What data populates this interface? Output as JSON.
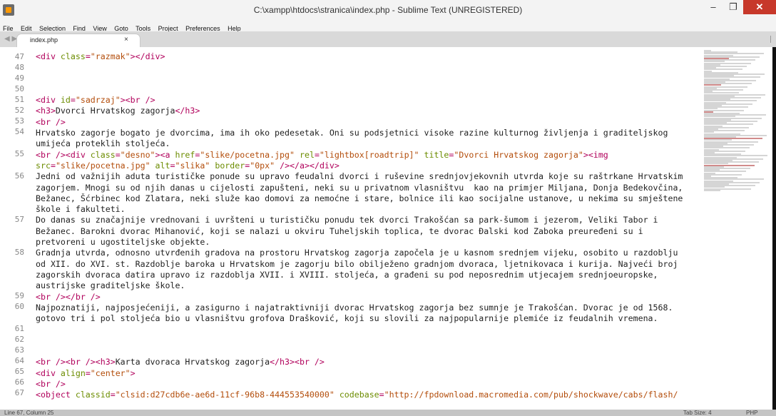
{
  "window": {
    "title": "C:\\xampp\\htdocs\\stranica\\index.php - Sublime Text (UNREGISTERED)",
    "minimize": "–",
    "maximize": "❐",
    "close": "✕"
  },
  "menu": [
    "File",
    "Edit",
    "Selection",
    "Find",
    "View",
    "Goto",
    "Tools",
    "Project",
    "Preferences",
    "Help"
  ],
  "tabs": [
    {
      "label": "index.php",
      "close": "×"
    }
  ],
  "nav_arrows": "◀ ▶",
  "editor": {
    "lines": [
      {
        "n": "47",
        "code": [
          [
            "tag",
            "<div "
          ],
          [
            "attr",
            "class"
          ],
          [
            "tag",
            "="
          ],
          [
            "str",
            "\"razmak\""
          ],
          [
            "tag",
            "></div>"
          ]
        ]
      },
      {
        "n": "48",
        "code": []
      },
      {
        "n": "49",
        "code": []
      },
      {
        "n": "50",
        "code": []
      },
      {
        "n": "51",
        "code": [
          [
            "tag",
            "<div "
          ],
          [
            "attr",
            "id"
          ],
          [
            "tag",
            "="
          ],
          [
            "str",
            "\"sadrzaj\""
          ],
          [
            "tag",
            "><br />"
          ]
        ]
      },
      {
        "n": "52",
        "code": [
          [
            "tag",
            "<h3>"
          ],
          [
            "txt",
            "Dvorci Hrvatskog zagorja"
          ],
          [
            "tag",
            "</h3>"
          ]
        ]
      },
      {
        "n": "53",
        "code": [
          [
            "tag",
            "<br />"
          ]
        ]
      },
      {
        "n": "54",
        "code": [
          [
            "txt",
            "Hrvatsko zagorje bogato je dvorcima, ima ih oko pedesetak. Oni su podsjetnici visoke razine kulturnog življenja i graditeljskog umijeća proteklih stoljeća."
          ]
        ]
      },
      {
        "n": "55",
        "code": [
          [
            "tag",
            "<br /><div "
          ],
          [
            "attr",
            "class"
          ],
          [
            "tag",
            "="
          ],
          [
            "str",
            "\"desno\""
          ],
          [
            "tag",
            "><a "
          ],
          [
            "attr",
            "href"
          ],
          [
            "tag",
            "="
          ],
          [
            "str",
            "\"slike/pocetna.jpg\""
          ],
          [
            "tag",
            " "
          ],
          [
            "attr",
            "rel"
          ],
          [
            "tag",
            "="
          ],
          [
            "str",
            "\"lightbox[roadtrip]\""
          ],
          [
            "tag",
            " "
          ],
          [
            "attr",
            "title"
          ],
          [
            "tag",
            "="
          ],
          [
            "str",
            "\"Dvorci Hrvatskog zagorja\""
          ],
          [
            "tag",
            "><img "
          ],
          [
            "attr",
            "src"
          ],
          [
            "tag",
            "="
          ],
          [
            "str",
            "\"slike/pocetna.jpg\""
          ],
          [
            "tag",
            " "
          ],
          [
            "attr",
            "alt"
          ],
          [
            "tag",
            "="
          ],
          [
            "str",
            "\"slika\""
          ],
          [
            "tag",
            " "
          ],
          [
            "attr",
            "border"
          ],
          [
            "tag",
            "="
          ],
          [
            "str",
            "\"0px\""
          ],
          [
            "tag",
            " /></a></div>"
          ]
        ]
      },
      {
        "n": "56",
        "code": [
          [
            "txt",
            "Jedni od važnijih aduta turističke ponude su upravo feudalni dvorci i ruševine srednjovjekovnih utvrda koje su raštrkane Hrvatskim zagorjem. Mnogi su od njih danas u cijelosti zapušteni, neki su u privatnom vlasništvu  kao na primjer Miljana, Donja Bedekovčina, Bežanec, Šćrbinec kod Zlatara, neki služe kao domovi za nemoćne i stare, bolnice ili kao socijalne ustanove, u nekima su smještene škole i fakulteti."
          ]
        ]
      },
      {
        "n": "57",
        "code": [
          [
            "txt",
            "Do danas su značajnije vrednovani i uvršteni u turističku ponudu tek dvorci Trakošćan sa park-šumom i jezerom, Veliki Tabor i Bežanec. Barokni dvorac Mihanović, koji se nalazi u okviru Tuheljskih toplica, te dvorac Đalski kod Zaboka preuređeni su i pretvoreni u ugostiteljske objekte."
          ]
        ]
      },
      {
        "n": "58",
        "code": [
          [
            "txt",
            "Gradnja utvrda, odnosno utvrđenih gradova na prostoru Hrvatskog zagorja započela je u kasnom srednjem vijeku, osobito u razdoblju od XII. do XVI. st. Razdoblje baroka u Hrvatskom je zagorju bilo obilježeno gradnjom dvoraca, ljetnikovaca i kurija. Najveći broj zagorskih dvoraca datira upravo iz razdoblja XVII. i XVIII. stoljeća, a građeni su pod neposrednim utjecajem srednjoeuropske, austrijske graditeljske škole."
          ]
        ]
      },
      {
        "n": "59",
        "code": [
          [
            "tag",
            "<br /></br />"
          ]
        ]
      },
      {
        "n": "60",
        "code": [
          [
            "txt",
            "Najpoznatiji, najposjećeniji, a zasigurno i najatraktivniji dvorac Hrvatskog zagorja bez sumnje je Trakošćan. Dvorac je od 1568. gotovo tri i pol stoljeća bio u vlasništvu grofova Drašković, koji su slovili za najpopularnije plemiće iz feudalnih vremena."
          ]
        ]
      },
      {
        "n": "61",
        "code": []
      },
      {
        "n": "62",
        "code": []
      },
      {
        "n": "63",
        "code": []
      },
      {
        "n": "64",
        "code": [
          [
            "tag",
            "<br /><br /><h3>"
          ],
          [
            "txt",
            "Karta dvoraca Hrvatskog zagorja"
          ],
          [
            "tag",
            "</h3><br />"
          ]
        ]
      },
      {
        "n": "65",
        "code": [
          [
            "tag",
            "<div "
          ],
          [
            "attr",
            "align"
          ],
          [
            "tag",
            "="
          ],
          [
            "str",
            "\"center\""
          ],
          [
            "tag",
            ">"
          ]
        ]
      },
      {
        "n": "66",
        "code": [
          [
            "tag",
            "<br />"
          ]
        ]
      },
      {
        "n": "67",
        "code": [
          [
            "tag",
            "<object "
          ],
          [
            "attr",
            "classid"
          ],
          [
            "tag",
            "="
          ],
          [
            "str",
            "\"clsid:d27cdb6e-ae6d-11cf-96b8-444553540000\""
          ],
          [
            "tag",
            " "
          ],
          [
            "attr",
            "codebase"
          ],
          [
            "tag",
            "="
          ],
          [
            "str",
            "\"http://fpdownload.macromedia.com/pub/shockwave/cabs/flash/"
          ]
        ]
      }
    ]
  },
  "status": {
    "position": "Line 67, Column 25",
    "tab_size": "Tab Size: 4",
    "syntax": "PHP"
  }
}
